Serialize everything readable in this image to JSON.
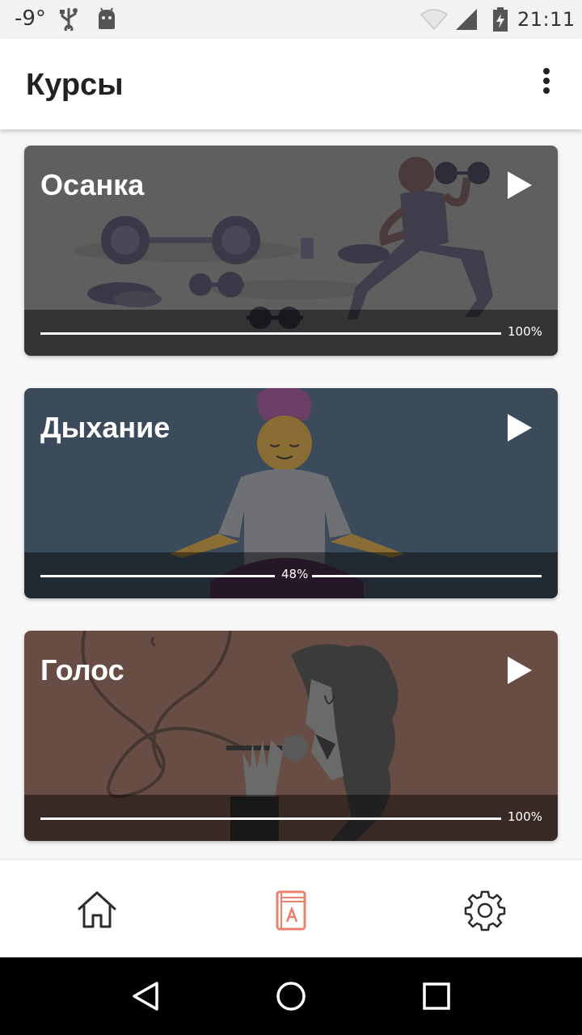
{
  "status_bar": {
    "temperature": "-9°",
    "time": "21:11"
  },
  "app_bar": {
    "title": "Курсы"
  },
  "courses": [
    {
      "title": "Осанка",
      "progress_label": "100%",
      "progress": 1.0,
      "color": "#5f5f5f"
    },
    {
      "title": "Дыхание",
      "progress_label": "48%",
      "progress": 0.48,
      "color": "#3c4b5c"
    },
    {
      "title": "Голос",
      "progress_label": "100%",
      "progress": 1.0,
      "color": "#684d45"
    }
  ],
  "bottom_nav": {
    "items": [
      {
        "icon": "home-icon",
        "active": false
      },
      {
        "icon": "book-icon",
        "active": true
      },
      {
        "icon": "gear-icon",
        "active": false
      }
    ],
    "active_color": "#e8806a"
  },
  "system_nav": {
    "icons": [
      "back-icon",
      "home-circle-icon",
      "recents-icon"
    ]
  }
}
